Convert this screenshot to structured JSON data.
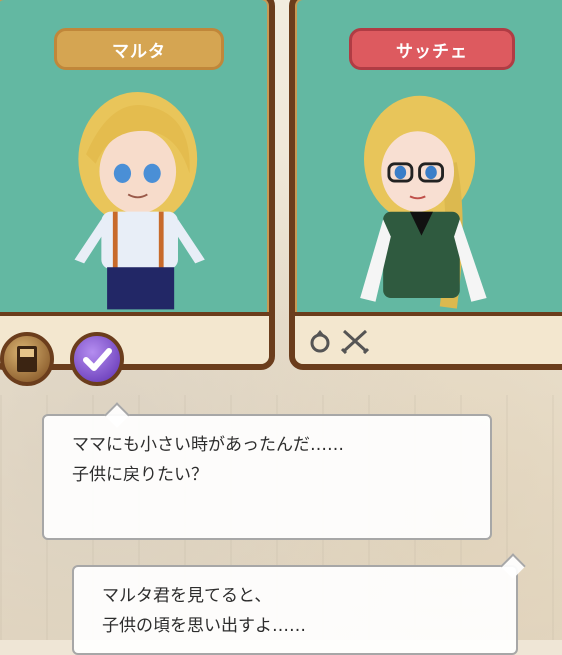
{
  "characters": {
    "left": {
      "name": "マルタ"
    },
    "right": {
      "name": "サッチェ"
    }
  },
  "colors": {
    "panel_bg": "#63b8a2",
    "frame": "#6b3d1c",
    "left_nameplate": "#d5a552",
    "right_nameplate": "#dd5a5f"
  },
  "icons": {
    "item_button": "book-icon",
    "skill_button": "checkmark-icon",
    "right_status": [
      "ring-icon",
      "crossed-swords-icon"
    ]
  },
  "dialogue": [
    {
      "lines": [
        "ママにも小さい時があったんだ……",
        "子供に戻りたい？"
      ]
    },
    {
      "lines": [
        "マルタ君を見てると、",
        "子供の頃を思い出すよ……"
      ]
    }
  ]
}
